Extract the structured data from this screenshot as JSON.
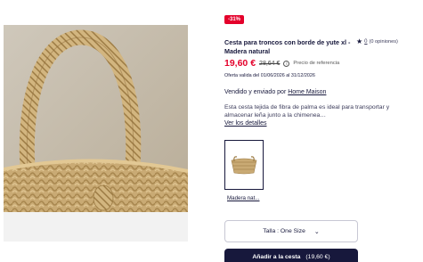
{
  "product": {
    "discount_badge": "-31%",
    "title": "Cesta para troncos con borde de yute xl - Madera natural",
    "rating_count": "0",
    "rating_text": "(0 opiniones)",
    "price": "19,60 €",
    "old_price": "28,64 €",
    "reference_label": "Precio de referencia",
    "offer_text": "Oferta valida del 01/06/2026 al 31/12/2026",
    "seller_prefix": "Vendido y enviado por",
    "seller_name": "Home Maison",
    "description": "Esta cesta tejida de fibra de palma es ideal para transportar y almacenar leña junto a la chimenea…",
    "details_link": "Ver los detalles",
    "variant_label": "Madera nat...",
    "size_label": "Talla : One Size",
    "add_to_cart_label": "Añadir a la cesta",
    "add_to_cart_price": "(19,60 €)"
  },
  "colors": {
    "accent_red": "#e4002b",
    "navy": "#17183c"
  },
  "icons": {
    "star": "star-icon",
    "info": "info-icon",
    "chevron": "chevron-down-icon"
  }
}
